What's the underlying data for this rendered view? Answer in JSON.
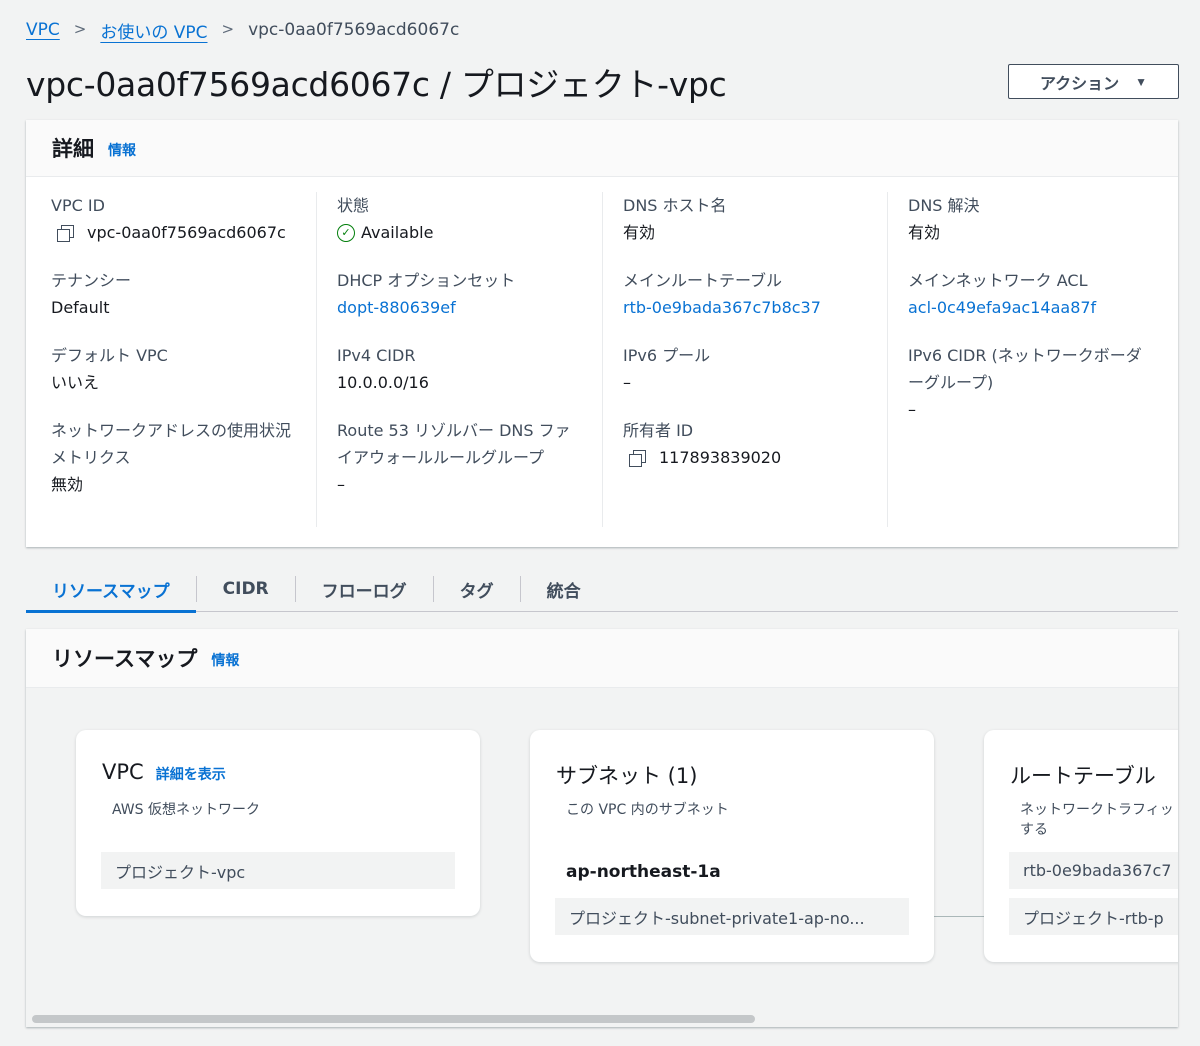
{
  "breadcrumb": {
    "items": [
      "VPC",
      "お使いの VPC"
    ],
    "current": "vpc-0aa0f7569acd6067c",
    "separator": ">"
  },
  "page": {
    "title": "vpc-0aa0f7569acd6067c / プロジェクト-vpc"
  },
  "actions": {
    "label": "アクション",
    "caret": "▼"
  },
  "details": {
    "heading": "詳細",
    "info": "情報",
    "columns": [
      [
        {
          "label": "VPC ID",
          "value": "vpc-0aa0f7569acd6067c"
        },
        {
          "label": "テナンシー",
          "value": "Default"
        },
        {
          "label": "デフォルト VPC",
          "value": "いいえ"
        },
        {
          "label": "ネットワークアドレスの使用状況メトリクス",
          "value": "無効"
        }
      ],
      [
        {
          "label": "状態",
          "value": "Available"
        },
        {
          "label": "DHCP オプションセット",
          "value": "dopt-880639ef"
        },
        {
          "label": "IPv4 CIDR",
          "value": "10.0.0.0/16"
        },
        {
          "label": "Route 53 リゾルバー DNS ファイアウォールルールグループ",
          "value": "–"
        }
      ],
      [
        {
          "label": "DNS ホスト名",
          "value": "有効"
        },
        {
          "label": "メインルートテーブル",
          "value": "rtb-0e9bada367c7b8c37"
        },
        {
          "label": "IPv6 プール",
          "value": "–"
        },
        {
          "label": "所有者 ID",
          "value": "117893839020"
        }
      ],
      [
        {
          "label": "DNS 解決",
          "value": "有効"
        },
        {
          "label": "メインネットワーク ACL",
          "value": "acl-0c49efa9ac14aa87f"
        },
        {
          "label": "IPv6 CIDR (ネットワークボーダーグループ)",
          "value": "–"
        }
      ]
    ]
  },
  "tabs": [
    "リソースマップ",
    "CIDR",
    "フローログ",
    "タグ",
    "統合"
  ],
  "resource_map": {
    "heading": "リソースマップ",
    "info": "情報",
    "vpc_card": {
      "title": "VPC",
      "link": "詳細を表示",
      "subtitle": "AWS 仮想ネットワーク",
      "item": "プロジェクト-vpc"
    },
    "subnet_card": {
      "title": "サブネット (1)",
      "subtitle": "この VPC 内のサブネット",
      "az": "ap-northeast-1a",
      "item": "プロジェクト-subnet-private1-ap-no..."
    },
    "route_card": {
      "title": "ルートテーブル",
      "subtitle_line1": "ネットワークトラフィッ",
      "subtitle_line2": "する",
      "item1": "rtb-0e9bada367c7",
      "item2": "プロジェクト-rtb-p"
    }
  },
  "colors": {
    "link": "#0972d3",
    "success": "#037f0c",
    "text": "#16191f",
    "secondary": "#414d5c"
  }
}
